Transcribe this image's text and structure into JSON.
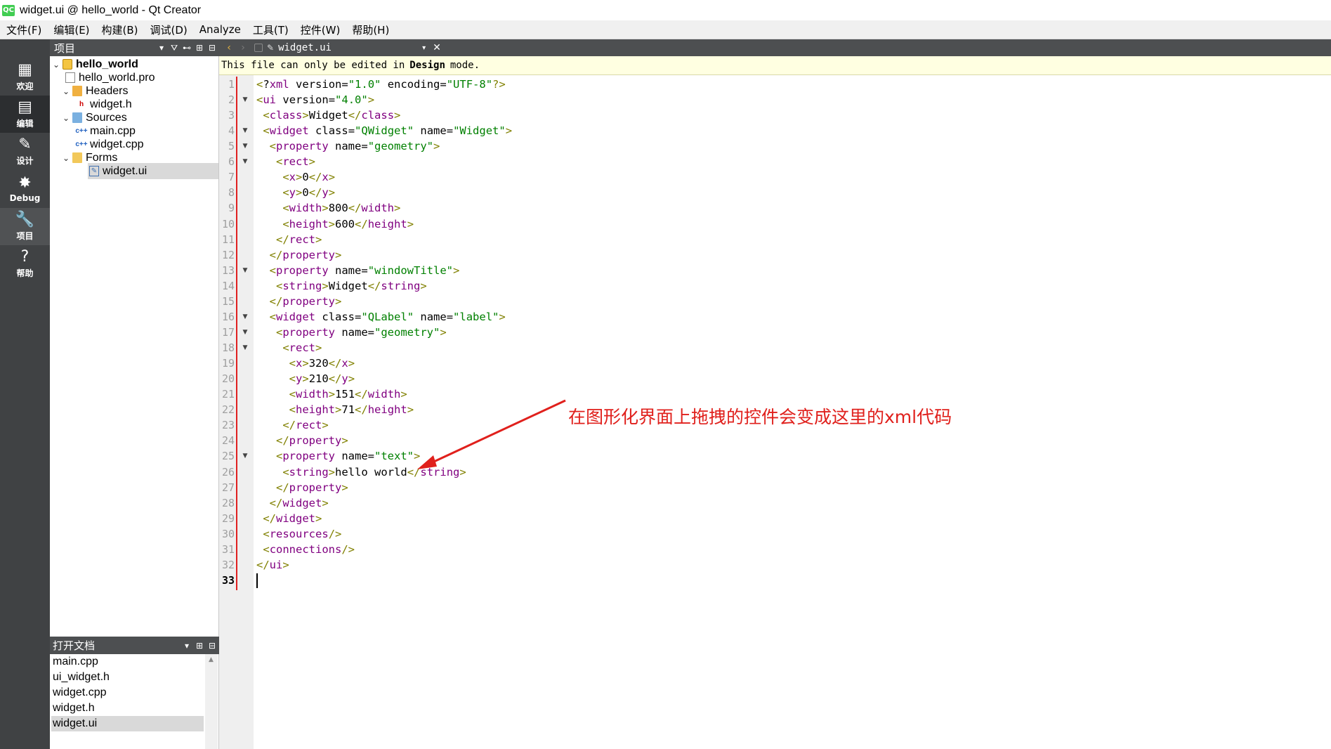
{
  "window": {
    "title": "widget.ui @ hello_world - Qt Creator",
    "logo": "QC"
  },
  "menu": [
    "文件(F)",
    "编辑(E)",
    "构建(B)",
    "调试(D)",
    "Analyze",
    "工具(T)",
    "控件(W)",
    "帮助(H)"
  ],
  "modes": [
    {
      "label": "欢迎",
      "icon": "▦"
    },
    {
      "label": "编辑",
      "icon": "▤"
    },
    {
      "label": "设计",
      "icon": "✎"
    },
    {
      "label": "Debug",
      "icon": "✸"
    },
    {
      "label": "项目",
      "icon": "🔧"
    },
    {
      "label": "帮助",
      "icon": "?"
    }
  ],
  "project_pane": {
    "title": "项目",
    "tree": [
      {
        "label": "hello_world",
        "bold": true
      },
      {
        "label": "hello_world.pro"
      },
      {
        "label": "Headers"
      },
      {
        "label": "widget.h"
      },
      {
        "label": "Sources"
      },
      {
        "label": "main.cpp"
      },
      {
        "label": "widget.cpp"
      },
      {
        "label": "Forms"
      },
      {
        "label": "widget.ui",
        "selected": true
      }
    ]
  },
  "open_docs": {
    "title": "打开文档",
    "items": [
      "main.cpp",
      "ui_widget.h",
      "widget.cpp",
      "widget.h",
      "widget.ui"
    ]
  },
  "editor": {
    "file_name": "widget.ui",
    "info_prefix": "This file can only be edited in",
    "info_bold": "Design",
    "info_suffix": "mode.",
    "current_line": 33,
    "lines": [
      "<?xml version=\"1.0\" encoding=\"UTF-8\"?>",
      "<ui version=\"4.0\">",
      " <class>Widget</class>",
      " <widget class=\"QWidget\" name=\"Widget\">",
      "  <property name=\"geometry\">",
      "   <rect>",
      "    <x>0</x>",
      "    <y>0</y>",
      "    <width>800</width>",
      "    <height>600</height>",
      "   </rect>",
      "  </property>",
      "  <property name=\"windowTitle\">",
      "   <string>Widget</string>",
      "  </property>",
      "  <widget class=\"QLabel\" name=\"label\">",
      "   <property name=\"geometry\">",
      "    <rect>",
      "     <x>320</x>",
      "     <y>210</y>",
      "     <width>151</width>",
      "     <height>71</height>",
      "    </rect>",
      "   </property>",
      "   <property name=\"text\">",
      "    <string>hello world</string>",
      "   </property>",
      "  </widget>",
      " </widget>",
      " <resources/>",
      " <connections/>",
      "</ui>",
      ""
    ],
    "fold_lines": [
      2,
      4,
      5,
      6,
      13,
      16,
      17,
      18,
      25
    ]
  },
  "annotation": {
    "text": "在图形化界面上拖拽的控件会变成这里的xml代码",
    "color": "#e0201c"
  },
  "colors": {
    "mode_bar": "#404244",
    "pane_header": "#4d4f51",
    "info_bar": "#ffffe1",
    "xml_tag": "#808000",
    "xml_element": "#800080",
    "xml_value": "#008000"
  }
}
